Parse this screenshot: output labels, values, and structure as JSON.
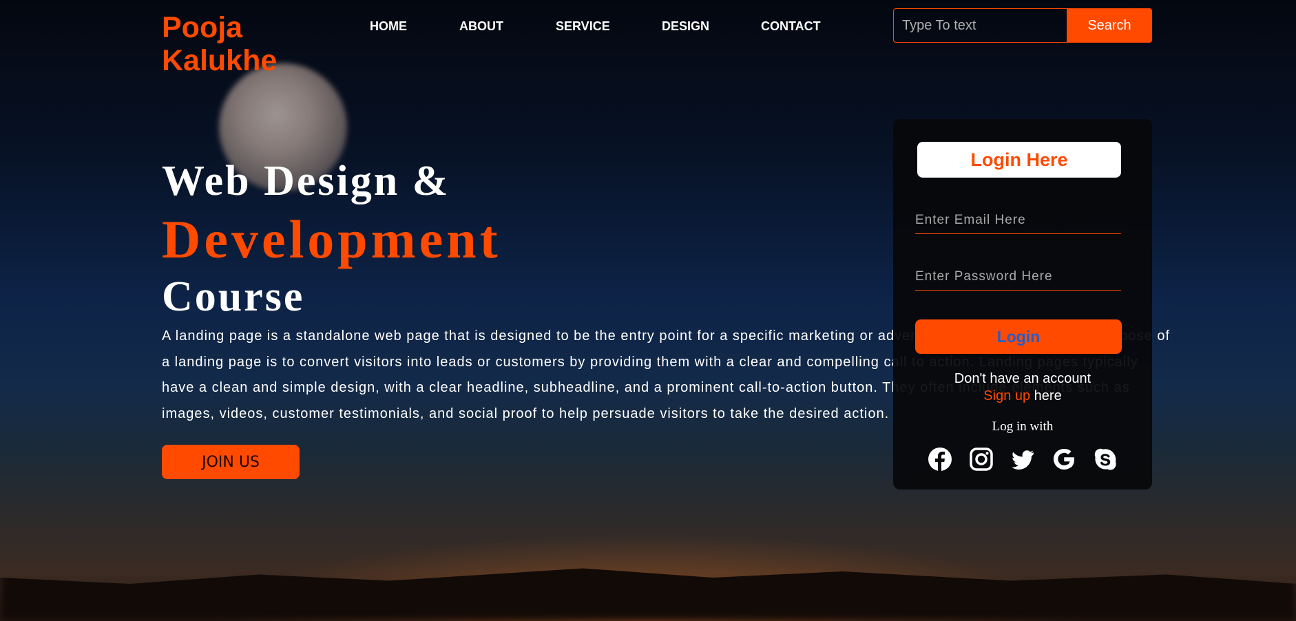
{
  "brand": {
    "line1": "Pooja",
    "line2": "Kalukhe"
  },
  "nav": {
    "items": [
      "HOME",
      "ABOUT",
      "SERVICE",
      "DESIGN",
      "CONTACT"
    ]
  },
  "search": {
    "placeholder": "Type To text",
    "button": "Search"
  },
  "hero": {
    "line1": "Web Design &",
    "line2": "Development",
    "line3": "Course",
    "description": "A landing page is a standalone web page that is designed to be the entry point for a specific marketing or advertising campaign. The main purpose of a landing page is to convert visitors into leads or customers by providing them with a clear and compelling call to action. Landing pages typically have a clean and simple design, with a clear headline, subheadline, and a prominent call-to-action button. They often include elements such as images, videos, customer testimonials, and social proof to help persuade visitors to take the desired action.",
    "cta": "JOIN US"
  },
  "login": {
    "title": "Login Here",
    "email_placeholder": "Enter Email Here",
    "password_placeholder": "Enter Password Here",
    "button": "Login",
    "no_account": "Don't have an account",
    "signup_link": "Sign up",
    "signup_suffix": " here",
    "login_with": "Log in with",
    "socials": [
      "facebook-icon",
      "instagram-icon",
      "twitter-icon",
      "google-icon",
      "skype-icon"
    ]
  },
  "colors": {
    "accent": "#ff4a00",
    "login_text": "#1f5fd0",
    "panel_bg": "#08080a"
  }
}
